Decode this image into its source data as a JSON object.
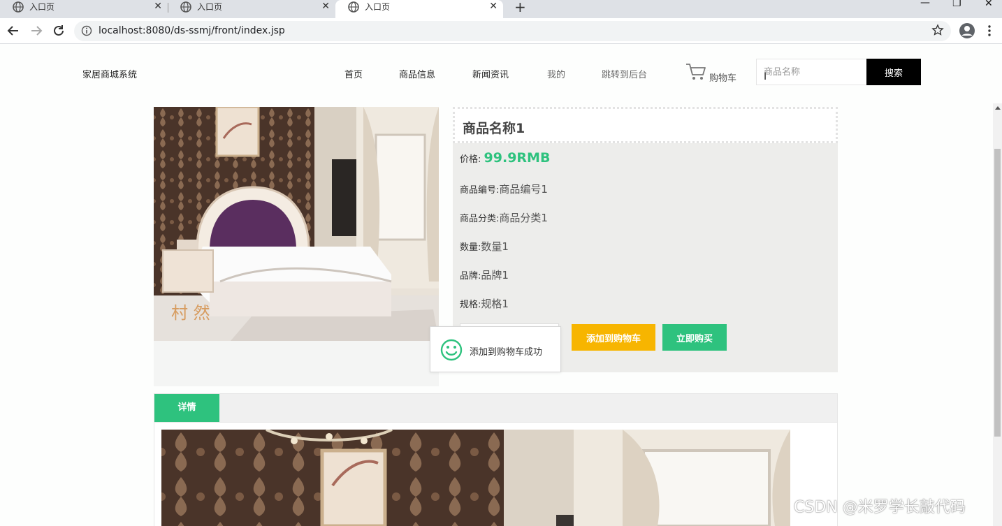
{
  "browser": {
    "tabs": [
      {
        "title": "入口页"
      },
      {
        "title": "入口页"
      },
      {
        "title": "入口页"
      }
    ],
    "url": "localhost:8080/ds-ssmj/front/index.jsp"
  },
  "header": {
    "brand": "家居商城系统",
    "nav": [
      "首页",
      "商品信息",
      "新闻资讯",
      "我的",
      "跳转到后台"
    ],
    "cart_label": "购物车",
    "search_placeholder": "商品名称",
    "search_button": "搜索"
  },
  "product": {
    "name": "商品名称1",
    "price_label": "价格:",
    "price_value": "99.9RMB",
    "fields": [
      {
        "label": "商品编号:",
        "value": "商品编号1"
      },
      {
        "label": "商品分类:",
        "value": "商品分类1"
      },
      {
        "label": "数量:",
        "value": "数量1"
      },
      {
        "label": "品牌:",
        "value": "品牌1"
      },
      {
        "label": "规格:",
        "value": "规格1"
      }
    ],
    "add_to_cart": "添加到购物车",
    "buy_now": "立即购买",
    "image_watermark": "村 然"
  },
  "toast": {
    "message": "添加到购物车成功"
  },
  "detail": {
    "tab_label": "详情"
  },
  "watermark": "CSDN @米罗学长敲代码",
  "colors": {
    "accent_green": "#2ec27e",
    "accent_orange": "#f7b500",
    "search_button_bg": "#000000"
  }
}
